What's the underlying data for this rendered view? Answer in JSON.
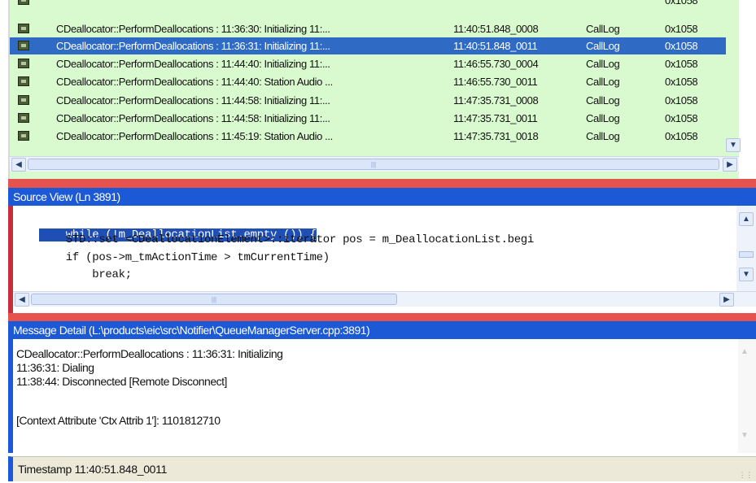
{
  "log": {
    "rows": [
      {
        "msg": "CDeallocator::PerformDeallocations : 11:36:30: Initializing 11:...",
        "time": "11:40:51.848_0008",
        "src": "CallLog",
        "tid": "0x1058"
      },
      {
        "msg": "CDeallocator::PerformDeallocations : 11:36:31: Initializing 11:...",
        "time": "11:40:51.848_0011",
        "src": "CallLog",
        "tid": "0x1058"
      },
      {
        "msg": "CDeallocator::PerformDeallocations : 11:44:40: Initializing 11:...",
        "time": "11:46:55.730_0004",
        "src": "CallLog",
        "tid": "0x1058"
      },
      {
        "msg": "CDeallocator::PerformDeallocations : 11:44:40: Station Audio ...",
        "time": "11:46:55.730_0011",
        "src": "CallLog",
        "tid": "0x1058"
      },
      {
        "msg": "CDeallocator::PerformDeallocations : 11:44:58: Initializing 11:...",
        "time": "11:47:35.731_0008",
        "src": "CallLog",
        "tid": "0x1058"
      },
      {
        "msg": "CDeallocator::PerformDeallocations : 11:44:58: Initializing 11:...",
        "time": "11:47:35.731_0011",
        "src": "CallLog",
        "tid": "0x1058"
      },
      {
        "msg": "CDeallocator::PerformDeallocations : 11:45:19: Station Audio ...",
        "time": "11:47:35.731_0018",
        "src": "CallLog",
        "tid": "0x1058"
      }
    ],
    "cut_row_tid": "0x1058"
  },
  "source_view": {
    "title": "Source View (Ln 3891)",
    "lines": [
      "    while (!m_DeallocationList.empty ()) {",
      "        STD::set <CDeallocationElement>::iterator pos = m_DeallocationList.begi",
      "        if (pos->m_tmActionTime > tmCurrentTime)",
      "            break;"
    ]
  },
  "message_detail": {
    "title": "Message Detail (L:\\products\\eic\\src\\Notifier\\QueueManagerServer.cpp:3891)",
    "lines": [
      "CDeallocator::PerformDeallocations : 11:36:31: Initializing",
      "11:36:31: Dialing",
      "11:38:44: Disconnected [Remote Disconnect]",
      "",
      "[Context Attribute 'Ctx Attrib 1']: 1101812710"
    ]
  },
  "status": {
    "text": "Timestamp 11:40:51.848_0011"
  },
  "colors": {
    "row_bg": "#d9f9cf",
    "selected_row": "#2f6bc5",
    "header_blue": "#1b59d6",
    "splitter_red": "#e6534f"
  }
}
